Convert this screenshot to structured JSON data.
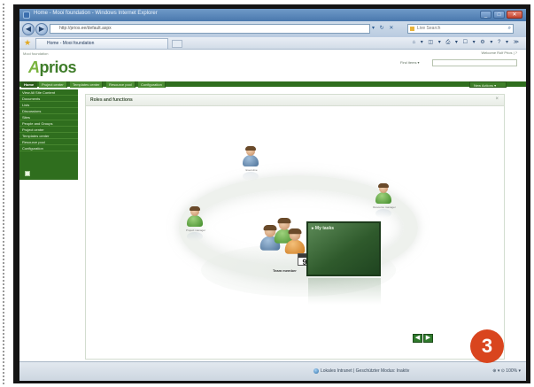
{
  "window": {
    "title": "Home - Mooi foundation - Windows Internet Explorer",
    "url": "http://prios.ee/default.aspx",
    "url_icons": "▾ ↻ ✕",
    "live_search": "Live Search",
    "live_go": "⌕",
    "tab_label": "Home - Mooi foundation",
    "command_icons": "⌂ ▾ ◫ ▾ ⎙ ▾ ☐ ▾ ⚙ ▾ ? ▾ ≫",
    "buttons": {
      "minimize": "_",
      "maximize": "□",
      "close": "✕"
    }
  },
  "app": {
    "breadcrumb": "Mooi foundation",
    "user_line": "Welcome Rolf Prios  |  ?",
    "logo_a": "A",
    "logo_rest": "prios",
    "search_label": "Find items ▾",
    "tabs": [
      {
        "label": "Home",
        "active": true
      },
      {
        "label": "Project center",
        "active": false
      },
      {
        "label": "Templates center",
        "active": false
      },
      {
        "label": "Resource pool",
        "active": false
      },
      {
        "label": "Configuration",
        "active": false
      }
    ],
    "new_button": "New Actions ▾",
    "nav": [
      "View All Site Content",
      "Documents",
      "Lists",
      "Discussions",
      "Sites",
      "People and Groups",
      "Project center",
      "Templates center",
      "Resource pool",
      "Configuration"
    ],
    "panel_title": "Roles and functions",
    "panel_close": "×",
    "team_label": "Team member",
    "tasks_title": "▸ My tasks",
    "calendar_day": "9",
    "person_labels": {
      "top": "Executive",
      "left": "Project manager",
      "right": "Resource manager"
    },
    "arrows": [
      "◀",
      "▶"
    ]
  },
  "status": {
    "text": "Lokales Intranet | Geschützter Modus: Inaktiv",
    "zoom": "⊕ ▾  ⊙ 100%  ▾"
  },
  "badge": "3"
}
